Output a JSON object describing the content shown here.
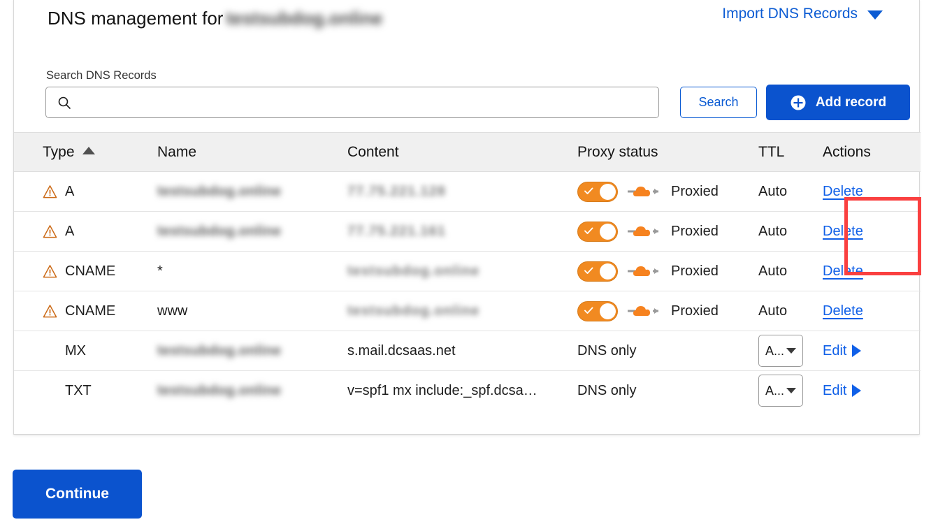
{
  "header": {
    "title_prefix": "DNS management for",
    "domain_redacted": "testsubdog.online",
    "import_label": "Import DNS Records",
    "chevron_icon": "chevron-down-icon"
  },
  "search": {
    "label": "Search DNS Records",
    "value": "",
    "placeholder": "",
    "icon": "search-icon",
    "search_button": "Search",
    "add_button": "Add record",
    "add_icon": "plus-circle-icon"
  },
  "table": {
    "columns": [
      "Type",
      "Name",
      "Content",
      "Proxy status",
      "TTL",
      "Actions"
    ],
    "sort_column": "Type",
    "sort_direction": "asc",
    "sort_icon": "triangle-up-icon",
    "rows": [
      {
        "warning": true,
        "warning_icon": "warning-triangle-icon",
        "type": "A",
        "name": "testsubdog.online",
        "name_redacted": true,
        "content": "77.75.221.128",
        "content_redacted": true,
        "proxy_toggle": true,
        "proxy_status": "Proxied",
        "proxy_icon": "cloud-proxied-icon",
        "ttl": "Auto",
        "ttl_is_select": false,
        "action": "Delete",
        "action_type": "delete"
      },
      {
        "warning": true,
        "warning_icon": "warning-triangle-icon",
        "type": "A",
        "name": "testsubdog.online",
        "name_redacted": true,
        "content": "77.75.221.161",
        "content_redacted": true,
        "proxy_toggle": true,
        "proxy_status": "Proxied",
        "proxy_icon": "cloud-proxied-icon",
        "ttl": "Auto",
        "ttl_is_select": false,
        "action": "Delete",
        "action_type": "delete"
      },
      {
        "warning": true,
        "warning_icon": "warning-triangle-icon",
        "type": "CNAME",
        "name": "*",
        "name_redacted": false,
        "content": "testsubdog.online",
        "content_redacted": true,
        "proxy_toggle": true,
        "proxy_status": "Proxied",
        "proxy_icon": "cloud-proxied-icon",
        "ttl": "Auto",
        "ttl_is_select": false,
        "action": "Delete",
        "action_type": "delete"
      },
      {
        "warning": true,
        "warning_icon": "warning-triangle-icon",
        "type": "CNAME",
        "name": "www",
        "name_redacted": false,
        "content": "testsubdog.online",
        "content_redacted": true,
        "proxy_toggle": true,
        "proxy_status": "Proxied",
        "proxy_icon": "cloud-proxied-icon",
        "ttl": "Auto",
        "ttl_is_select": false,
        "action": "Delete",
        "action_type": "delete"
      },
      {
        "warning": false,
        "type": "MX",
        "name": "testsubdog.online",
        "name_redacted": true,
        "content": "s.mail.dcsaas.net",
        "content_redacted": false,
        "proxy_toggle": false,
        "proxy_status": "DNS only",
        "ttl": "A...",
        "ttl_is_select": true,
        "action": "Edit",
        "action_type": "edit",
        "action_icon": "triangle-right-icon"
      },
      {
        "warning": false,
        "type": "TXT",
        "name": "testsubdog.online",
        "name_redacted": true,
        "content": "v=spf1 mx include:_spf.dcsa…",
        "content_redacted": false,
        "proxy_toggle": false,
        "proxy_status": "DNS only",
        "ttl": "A...",
        "ttl_is_select": true,
        "action": "Edit",
        "action_type": "edit",
        "action_icon": "triangle-right-icon"
      }
    ]
  },
  "footer": {
    "continue_label": "Continue"
  },
  "annotation": {
    "shape": "rectangle",
    "color": "#fa4040",
    "targets": [
      "row-1 Delete",
      "row-2 Delete"
    ]
  },
  "colors": {
    "primary_blue": "#0b53ce",
    "link_blue": "#1060e8",
    "import_blue": "#0b5bd3",
    "proxy_orange": "#f18a21",
    "warning_orange": "#d2691e",
    "annotation_red": "#fa4040",
    "header_bg": "#f0f0f0"
  }
}
